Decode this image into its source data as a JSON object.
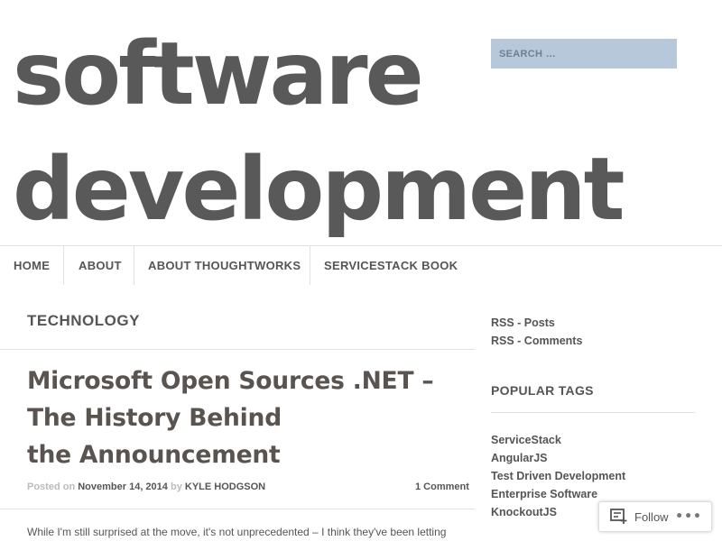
{
  "site": {
    "title_line1": "software",
    "title_line2": "development"
  },
  "search": {
    "placeholder": "SEARCH …"
  },
  "nav": {
    "items": [
      {
        "label": "HOME"
      },
      {
        "label": "ABOUT"
      },
      {
        "label": "ABOUT THOUGHTWORKS"
      },
      {
        "label": "SERVICESTACK BOOK"
      }
    ]
  },
  "archive": {
    "category_title": "TECHNOLOGY"
  },
  "post": {
    "title_line1": "Microsoft Open Sources .NET –",
    "title_line2": "The History Behind",
    "title_line3": "the Announcement",
    "posted_on_label": "Posted on",
    "date": "November 14, 2014",
    "by_label": "by",
    "author": "KYLE HODGSON",
    "comments": "1 Comment",
    "excerpt": "While I'm still surprised at the move, it's not unprecedented – I think they've been letting"
  },
  "sidebar": {
    "rss_posts": "RSS - Posts",
    "rss_comments": "RSS - Comments",
    "popular_tags_title": "POPULAR TAGS",
    "tags": [
      {
        "label": "ServiceStack"
      },
      {
        "label": "AngularJS"
      },
      {
        "label": "Test Driven Development"
      },
      {
        "label": "Enterprise Software"
      },
      {
        "label": "KnockoutJS"
      }
    ]
  },
  "follow": {
    "label": "Follow",
    "icon": "reader-follow-icon",
    "more": "•••"
  },
  "colors": {
    "title": "#595959",
    "search_bg": "#b6c8d9",
    "text": "#555555",
    "meta_muted": "#bbbbbb",
    "divider": "#e2e2e2"
  }
}
